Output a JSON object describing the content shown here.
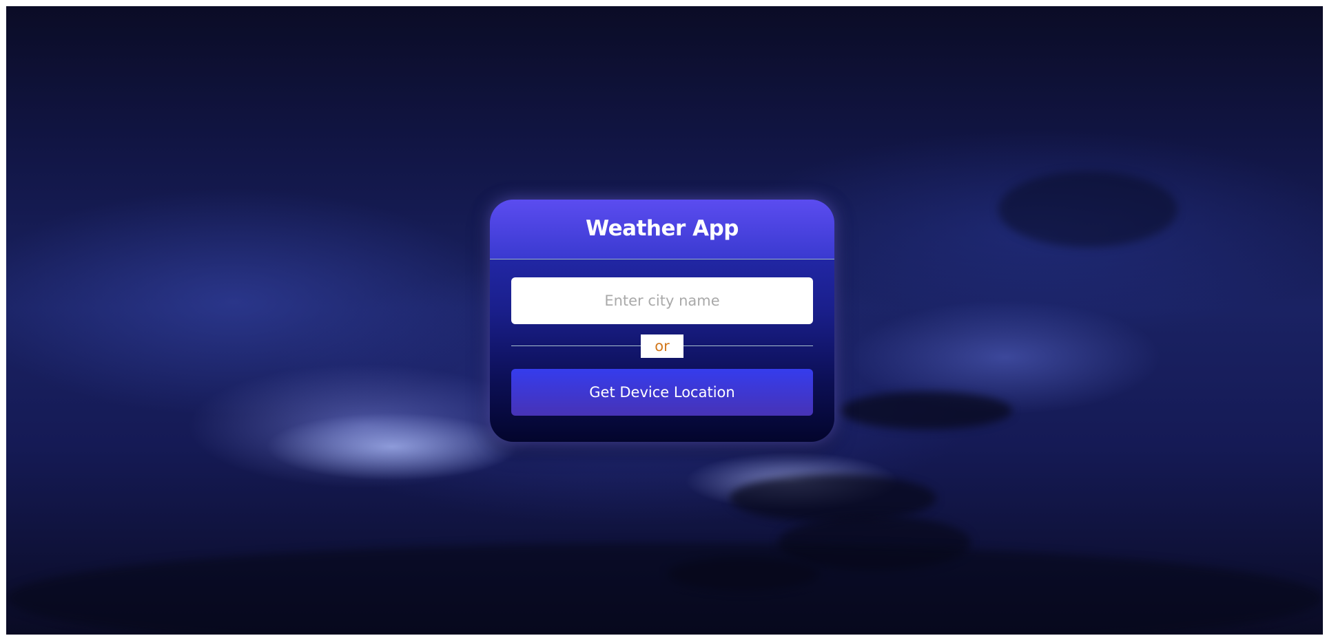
{
  "app": {
    "title": "Weather App"
  },
  "search": {
    "value": "",
    "placeholder": "Enter city name"
  },
  "separator": {
    "label": "or"
  },
  "location": {
    "button_label": "Get Device Location"
  },
  "colors": {
    "header_gradient_top": "#5b4cf0",
    "header_gradient_bottom": "#3a3ad0",
    "button_gradient_top": "#353ced",
    "button_gradient_bottom": "#4733b6",
    "separator_text": "#d2781c",
    "placeholder_text": "#a9a9a9",
    "page_frame": "#ffffff"
  },
  "background": {
    "scene": "night-sky-storm-clouds"
  }
}
